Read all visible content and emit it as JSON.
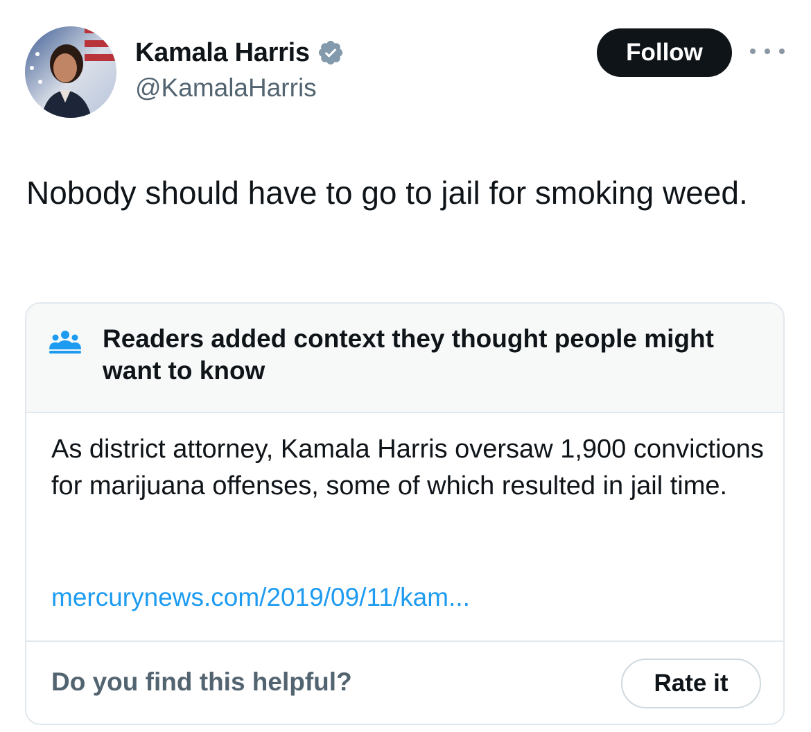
{
  "author": {
    "display_name": "Kamala Harris",
    "handle": "@KamalaHarris",
    "verified": true,
    "avatar_icon": "profile-photo"
  },
  "actions": {
    "follow_label": "Follow",
    "more_icon": "more-horizontal-icon"
  },
  "tweet": {
    "text": "Nobody should have to go to jail for smoking weed."
  },
  "community_note": {
    "header_icon": "readers-group-icon",
    "title": "Readers added context they thought people might want to know",
    "body": "As district attorney, Kamala Harris oversaw 1,900 convictions for marijuana offenses, some of which resulted in jail time.",
    "link": "mercurynews.com/2019/09/11/kam...",
    "helpful_prompt": "Do you find this helpful?",
    "rate_label": "Rate it"
  },
  "colors": {
    "text_primary": "#0f1419",
    "text_secondary": "#536471",
    "link": "#1d9bf0",
    "verified_badge": "#829aab",
    "note_header_bg": "#f7f9f9",
    "border": "#e1e8ed"
  }
}
